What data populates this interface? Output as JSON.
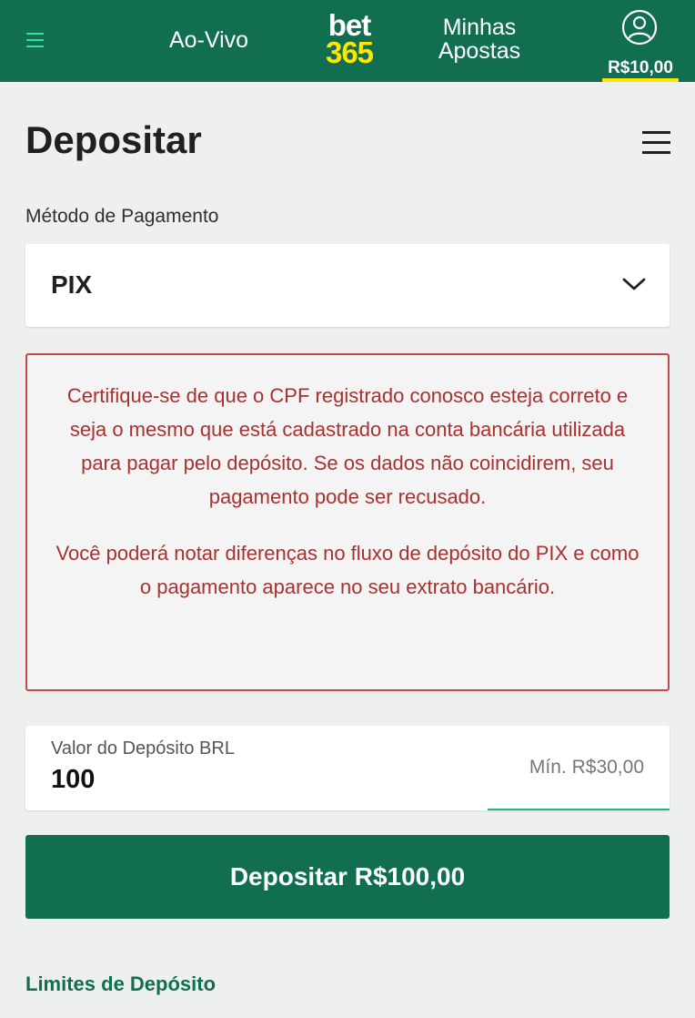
{
  "header": {
    "menu_icon": "hamburger-icon",
    "live_label": "Ao-Vivo",
    "logo_top": "bet",
    "logo_bottom": "365",
    "my_bets_line1": "Minhas",
    "my_bets_line2": "Apostas",
    "account_icon": "user-circle-icon",
    "balance": "R$10,00",
    "colors": {
      "background": "#126e51",
      "logo_accent": "#ffe600",
      "menu_icon": "#2fe0a0"
    }
  },
  "page": {
    "title": "Depositar",
    "options_icon": "menu-lines-icon"
  },
  "payment_method": {
    "label": "Método de Pagamento",
    "selected": "PIX",
    "dropdown_icon": "chevron-down-icon"
  },
  "warning": {
    "paragraph1": "Certifique-se de que o CPF registrado conosco esteja correto e seja o mesmo que está cadastrado na conta bancária utilizada para pagar pelo depósito. Se os dados não coincidirem, seu pagamento pode ser recusado.",
    "paragraph2": "Você poderá notar diferenças no fluxo de depósito do PIX e como o pagamento aparece no seu extrato bancário.",
    "color": "#a8322f"
  },
  "deposit_amount": {
    "label": "Valor do Depósito BRL",
    "value": "100",
    "minimum": "Mín. R$30,00"
  },
  "deposit_button": {
    "label": "Depositar R$100,00"
  },
  "limits_link": {
    "label": "Limites de Depósito"
  }
}
